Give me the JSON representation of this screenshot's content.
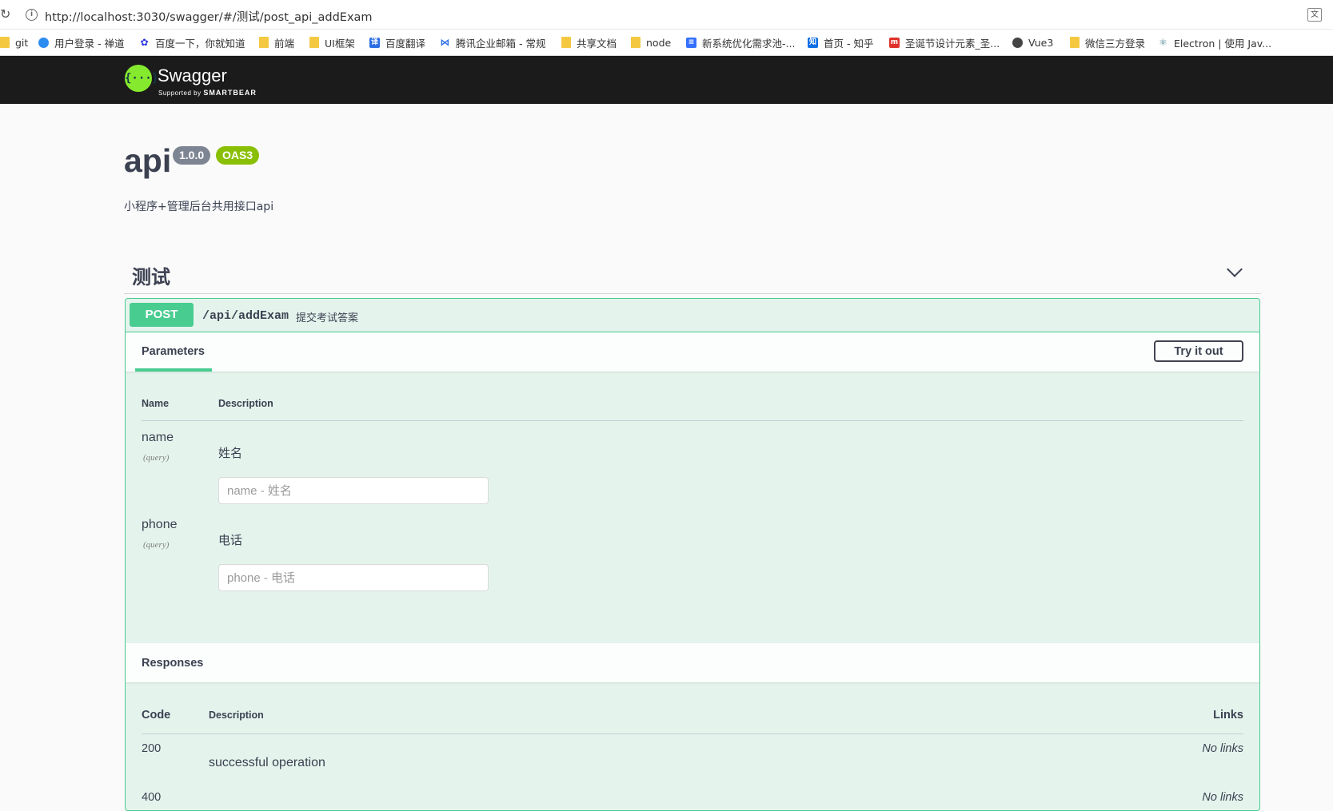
{
  "browser": {
    "url": "http://localhost:3030/swagger/#/测试/post_api_addExam",
    "bookmarks": [
      {
        "label": "git",
        "icon": "folder-icon"
      },
      {
        "label": "用户登录 - 禅道",
        "icon": "globe-icon"
      },
      {
        "label": "百度一下，你就知道",
        "icon": "baidu-icon"
      },
      {
        "label": "前端",
        "icon": "folder-icon"
      },
      {
        "label": "UI框架",
        "icon": "folder-icon"
      },
      {
        "label": "百度翻译",
        "icon": "translate-icon"
      },
      {
        "label": "腾讯企业邮箱 - 常规",
        "icon": "mail-icon"
      },
      {
        "label": "共享文档",
        "icon": "folder-icon"
      },
      {
        "label": "node",
        "icon": "folder-icon"
      },
      {
        "label": "新系统优化需求池-...",
        "icon": "doc-icon"
      },
      {
        "label": "首页 - 知乎",
        "icon": "zhihu-icon"
      },
      {
        "label": "圣诞节设计元素_圣...",
        "icon": "design-icon"
      },
      {
        "label": "Vue3",
        "icon": "globe-icon"
      },
      {
        "label": "微信三方登录",
        "icon": "folder-icon"
      },
      {
        "label": "Electron | 使用 Jav...",
        "icon": "electron-icon"
      }
    ]
  },
  "topbar": {
    "logo_mark": "{···}",
    "logo_text": "Swagger",
    "logo_sub_prefix": "Supported by",
    "logo_sub_brand": "SMARTBEAR"
  },
  "info": {
    "title": "api",
    "version": "1.0.0",
    "oas": "OAS3",
    "description": "小程序+管理后台共用接口api"
  },
  "tag": {
    "name": "测试"
  },
  "operation": {
    "method": "POST",
    "path": "/api/addExam",
    "summary": "提交考试答案",
    "parameters_tab": "Parameters",
    "try_button": "Try it out",
    "col_name": "Name",
    "col_description": "Description",
    "params": [
      {
        "name": "name",
        "in": "(query)",
        "description": "姓名",
        "placeholder": "name - 姓名"
      },
      {
        "name": "phone",
        "in": "(query)",
        "description": "电话",
        "placeholder": "phone - 电话"
      }
    ],
    "responses_title": "Responses",
    "resp_col_code": "Code",
    "resp_col_description": "Description",
    "resp_col_links": "Links",
    "responses": [
      {
        "code": "200",
        "description": "successful operation",
        "links": "No links"
      },
      {
        "code": "400",
        "description": "",
        "links": "No links"
      }
    ]
  }
}
